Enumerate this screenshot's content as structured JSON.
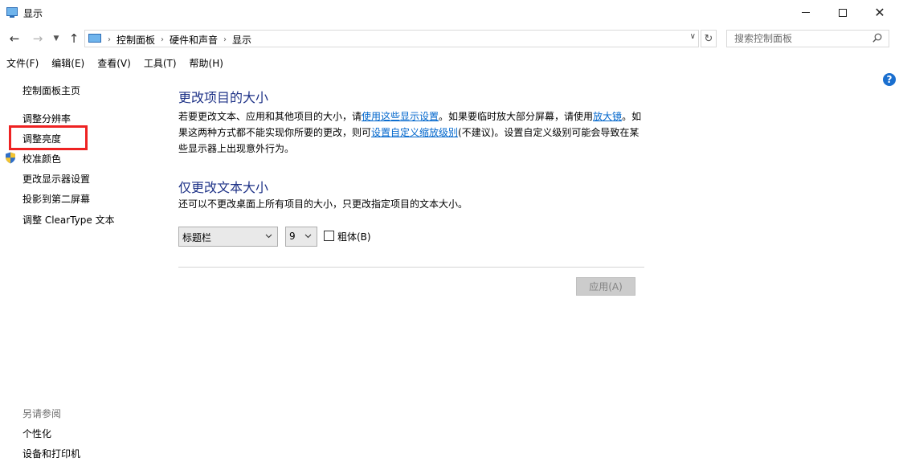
{
  "window": {
    "title": "显示",
    "icon": "monitor-icon"
  },
  "nav": {
    "breadcrumbs": [
      "控制面板",
      "硬件和声音",
      "显示"
    ],
    "search_placeholder": "搜索控制面板"
  },
  "menu": [
    {
      "label": "文件(F)"
    },
    {
      "label": "编辑(E)"
    },
    {
      "label": "查看(V)"
    },
    {
      "label": "工具(T)"
    },
    {
      "label": "帮助(H)"
    }
  ],
  "sidebar": {
    "home": "控制面板主页",
    "items": [
      "调整分辨率",
      "调整亮度",
      "校准颜色",
      "更改显示器设置",
      "投影到第二屏幕",
      "调整 ClearType 文本"
    ],
    "see_also_header": "另请参阅",
    "see_also": [
      "个性化",
      "设备和打印机"
    ],
    "highlight_color": "#ee2222"
  },
  "main": {
    "section1_title": "更改项目的大小",
    "section1_text": {
      "p1": "若要更改文本、应用和其他项目的大小，请",
      "link1": "使用这些显示设置",
      "p2": "。如果要临时放大部分屏幕，请使用",
      "link2": "放大镜",
      "p3": "。如果这两种方式都不能实现你所要的更改，则可",
      "link3": "设置自定义缩放级别",
      "p4": "(不建议)。设置自定义级别可能会导致在某些显示器上出现意外行为。"
    },
    "section2_title": "仅更改文本大小",
    "section2_text": "还可以不更改桌面上所有项目的大小，只更改指定项目的文本大小。",
    "item_select": "标题栏",
    "size_select": "9",
    "bold_label": "粗体(B)",
    "apply_label": "应用(A)"
  },
  "colors": {
    "heading": "#1e3287",
    "link": "#0066cc",
    "help": "#1a6fcf"
  }
}
